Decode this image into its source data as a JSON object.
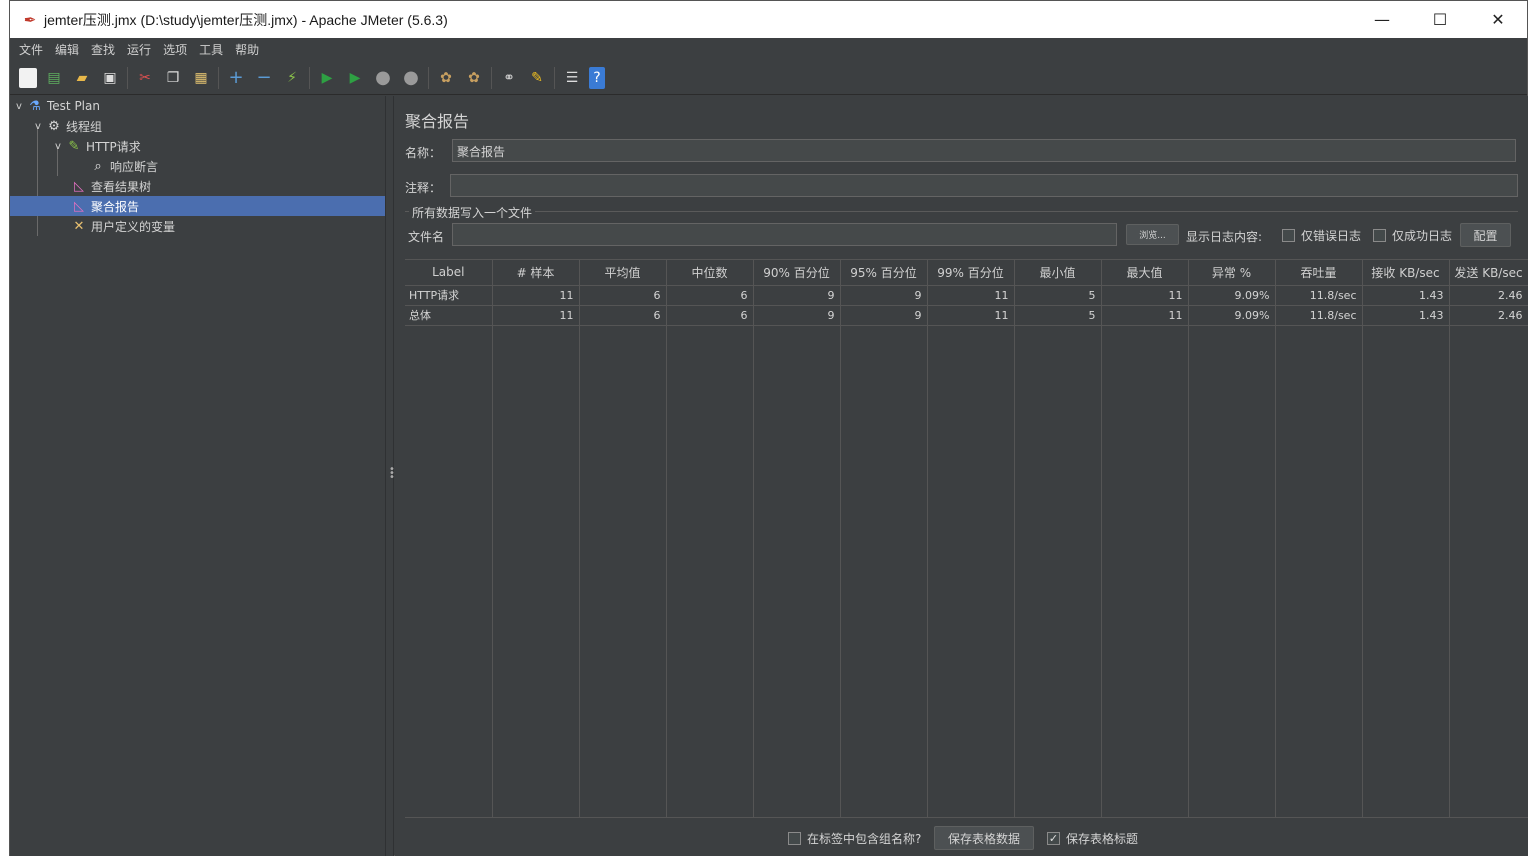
{
  "window": {
    "title": "jemter压测.jmx (D:\\study\\jemter压测.jmx) - Apache JMeter (5.6.3)",
    "minimize": "—",
    "maximize": "☐",
    "close": "✕"
  },
  "menu": [
    "文件",
    "编辑",
    "查找",
    "运行",
    "选项",
    "工具",
    "帮助"
  ],
  "toolbar": {
    "icons": [
      "new-icon",
      "templates-icon",
      "open-icon",
      "save-icon",
      "cut-icon",
      "copy-icon",
      "paste-icon",
      "expand-icon",
      "collapse-icon",
      "toggle-icon",
      "start-icon",
      "start-no-pause-icon",
      "stop-icon",
      "shutdown-icon",
      "clear-icon",
      "clear-all-icon",
      "search-icon",
      "reset-search-icon",
      "function-helper-icon",
      "help-icon"
    ]
  },
  "tree": {
    "items": [
      {
        "label": "Test Plan",
        "icon": "flask-icon"
      },
      {
        "label": "线程组",
        "icon": "gear-icon"
      },
      {
        "label": "HTTP请求",
        "icon": "pipette-icon"
      },
      {
        "label": "响应断言",
        "icon": "magnifier-icon"
      },
      {
        "label": "查看结果树",
        "icon": "graph-icon"
      },
      {
        "label": "聚合报告",
        "icon": "graph-icon"
      },
      {
        "label": "用户定义的变量",
        "icon": "tools-icon"
      }
    ],
    "selected": "聚合报告"
  },
  "panel": {
    "title": "聚合报告",
    "name_label": "名称：",
    "name_value": "聚合报告",
    "comment_label": "注释：",
    "comment_value": "",
    "group_title": "所有数据写入一个文件",
    "filename_label": "文件名",
    "filename_value": "",
    "browse_button": "浏览...",
    "log_content_label": "显示日志内容:",
    "errors_only": "仅错误日志",
    "success_only": "仅成功日志",
    "configure_button": "配置"
  },
  "table": {
    "headers": [
      "Label",
      "# 样本",
      "平均值",
      "中位数",
      "90% 百分位",
      "95% 百分位",
      "99% 百分位",
      "最小值",
      "最大值",
      "异常 %",
      "吞吐量",
      "接收 KB/sec",
      "发送 KB/sec"
    ],
    "rows": [
      [
        "HTTP请求",
        "11",
        "6",
        "6",
        "9",
        "9",
        "11",
        "5",
        "11",
        "9.09%",
        "11.8/sec",
        "1.43",
        "2.46"
      ],
      [
        "总体",
        "11",
        "6",
        "6",
        "9",
        "9",
        "11",
        "5",
        "11",
        "9.09%",
        "11.8/sec",
        "1.43",
        "2.46"
      ]
    ]
  },
  "bottom": {
    "include_group_label": "在标签中包含组名称?",
    "include_group_checked": false,
    "save_table_button": "保存表格数据",
    "save_header_label": "保存表格标题",
    "save_header_checked": true
  }
}
